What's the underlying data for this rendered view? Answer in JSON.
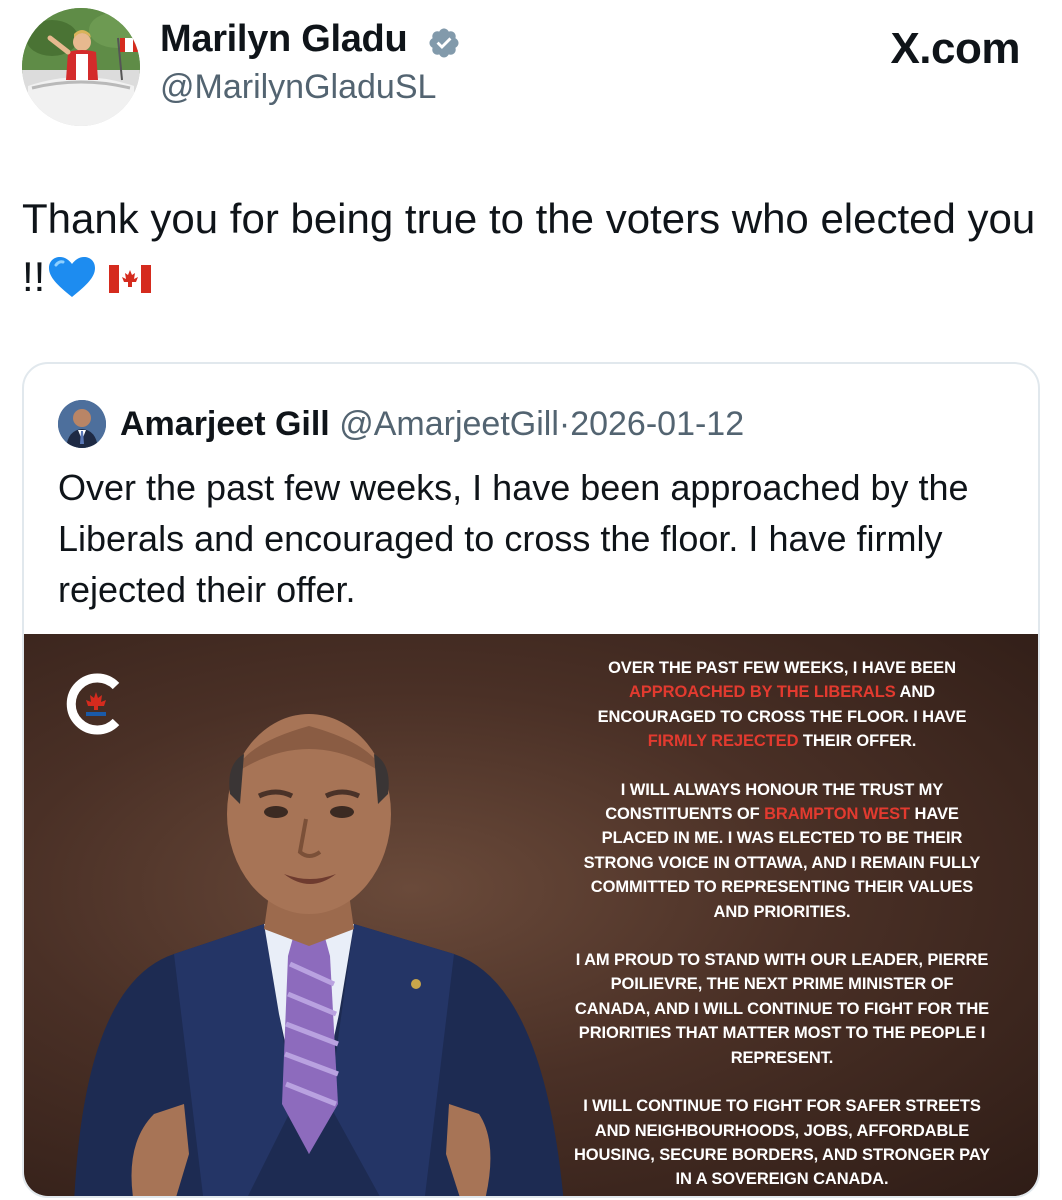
{
  "header": {
    "author_name": "Marilyn Gladu",
    "author_handle": "@MarilynGladuSL",
    "site_label": "X.com"
  },
  "tweet": {
    "text": "Thank you for being true to the voters who elected you !!",
    "emoji": [
      "blue-heart",
      "canada-flag"
    ]
  },
  "quote": {
    "name": "Amarjeet Gill",
    "handle": "@AmarjeetGill",
    "separator": "·",
    "date": "2026-01-12",
    "text": "Over the past few weeks, I have been approached by the Liberals and encouraged to cross the floor. I have firmly rejected their offer.",
    "image": {
      "logo": "conservative-party-logo",
      "paragraphs": [
        [
          {
            "t": "Over the past few weeks, I have been ",
            "hl": false
          },
          {
            "t": "approached by the Liberals",
            "hl": true
          },
          {
            "t": " and encouraged to cross the floor. I have ",
            "hl": false
          },
          {
            "t": "firmly rejected",
            "hl": true
          },
          {
            "t": " their offer.",
            "hl": false
          }
        ],
        [
          {
            "t": "I will always honour the trust my constituents of ",
            "hl": false
          },
          {
            "t": "Brampton West",
            "hl": true
          },
          {
            "t": " have placed in me. I was elected to be their strong voice in Ottawa, and I remain fully committed to representing their values and priorities.",
            "hl": false
          }
        ],
        [
          {
            "t": "I am proud to stand with our leader, Pierre Poilievre, the next Prime Minister of Canada, and I will continue to fight for the priorities that matter most to the people I represent.",
            "hl": false
          }
        ],
        [
          {
            "t": "I will continue to fight for safer streets and neighbourhoods, jobs, affordable housing, secure borders, and stronger pay in a sovereign Canada.",
            "hl": false
          }
        ]
      ]
    }
  },
  "colors": {
    "verified": "#829aab",
    "handle_gray": "#536471",
    "highlight_red": "#e23a2f",
    "heart_blue": "#1d8cf0"
  }
}
